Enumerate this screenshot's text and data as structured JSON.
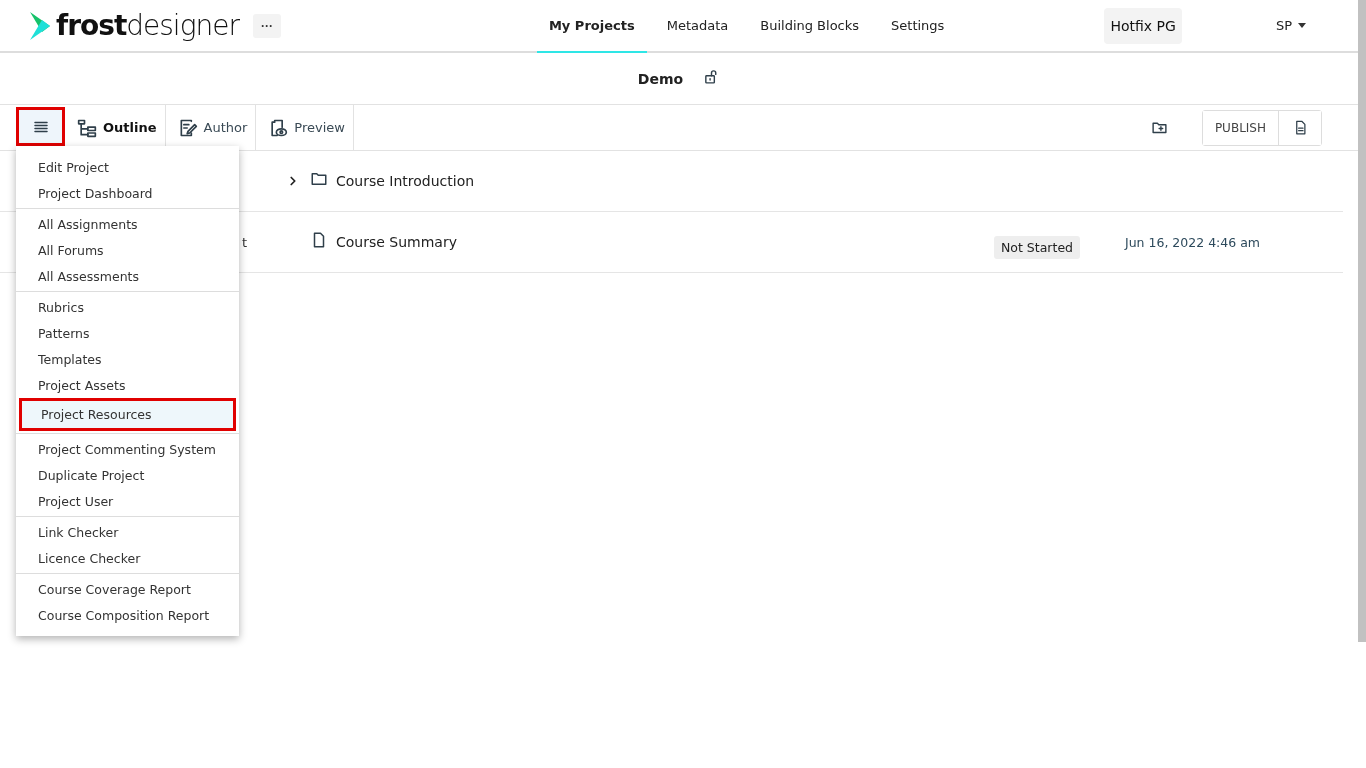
{
  "header": {
    "logo": {
      "bold": "frost",
      "light": "designer"
    },
    "more": "···",
    "nav": [
      {
        "label": "My Projects",
        "selected": true
      },
      {
        "label": "Metadata",
        "selected": false
      },
      {
        "label": "Building Blocks",
        "selected": false
      },
      {
        "label": "Settings",
        "selected": false
      }
    ],
    "workspace": "Hotfix PG",
    "user": "SP"
  },
  "project": {
    "title": "Demo",
    "locked": false
  },
  "toolbar": {
    "menu_highlighted": true,
    "menu_open": true,
    "tabs": [
      {
        "label": "Outline",
        "selected": true,
        "kind": "outline"
      },
      {
        "label": "Author",
        "selected": false,
        "kind": "author"
      },
      {
        "label": "Preview",
        "selected": false,
        "kind": "preview"
      }
    ],
    "publish": "PUBLISH"
  },
  "menu": {
    "groups": [
      [
        {
          "label": "Edit Project",
          "highlighted": false
        },
        {
          "label": "Project Dashboard",
          "highlighted": false
        }
      ],
      [
        {
          "label": "All Assignments",
          "highlighted": false
        },
        {
          "label": "All Forums",
          "highlighted": false
        },
        {
          "label": "All Assessments",
          "highlighted": false
        }
      ],
      [
        {
          "label": "Rubrics",
          "highlighted": false
        },
        {
          "label": "Patterns",
          "highlighted": false
        },
        {
          "label": "Templates",
          "highlighted": false
        },
        {
          "label": "Project Assets",
          "highlighted": false
        },
        {
          "label": "Project Resources",
          "highlighted": true
        }
      ],
      [
        {
          "label": "Project Commenting System",
          "highlighted": false
        },
        {
          "label": "Duplicate Project",
          "highlighted": false
        },
        {
          "label": "Project User",
          "highlighted": false
        }
      ],
      [
        {
          "label": "Link Checker",
          "highlighted": false
        },
        {
          "label": "Licence Checker",
          "highlighted": false
        }
      ],
      [
        {
          "label": "Course Coverage Report",
          "highlighted": false
        },
        {
          "label": "Course Composition Report",
          "highlighted": false
        }
      ]
    ]
  },
  "outline": [
    {
      "kind": "folder",
      "title": "Course Introduction",
      "expanded": false
    },
    {
      "kind": "page",
      "column_1": "t",
      "title": "Course Summary",
      "status": "Not Started",
      "date": "Jun 16, 2022 4:46 am"
    }
  ]
}
